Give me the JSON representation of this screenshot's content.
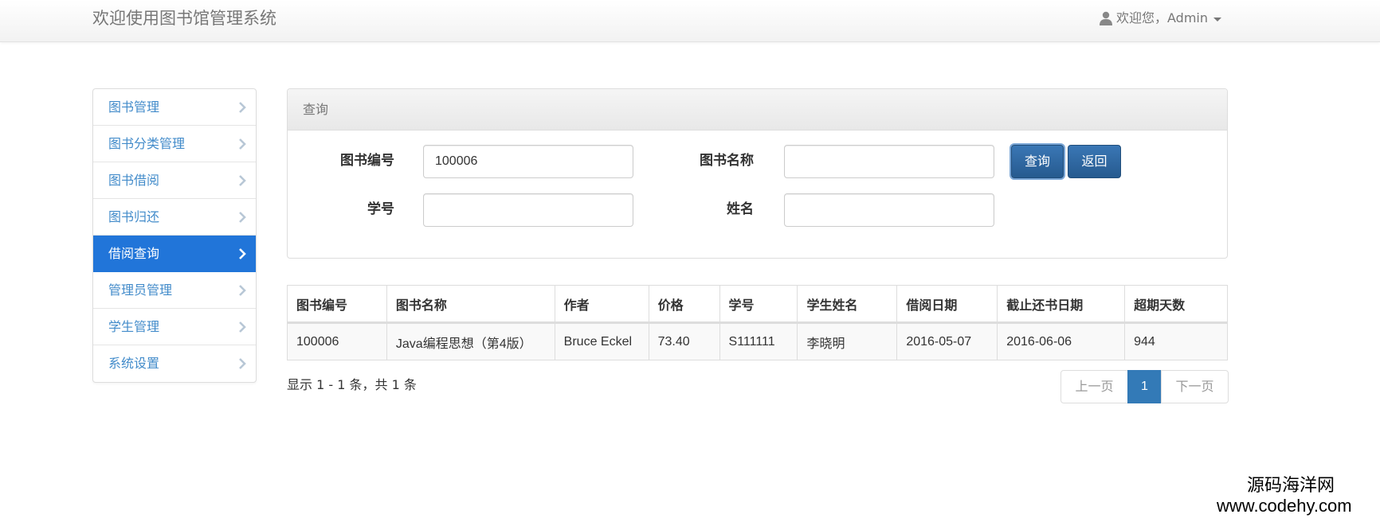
{
  "app": {
    "title": "欢迎使用图书馆管理系统",
    "user_greeting": "欢迎您，Admin"
  },
  "sidebar": {
    "items": [
      {
        "label": "图书管理"
      },
      {
        "label": "图书分类管理"
      },
      {
        "label": "图书借阅"
      },
      {
        "label": "图书归还"
      },
      {
        "label": "借阅查询",
        "active": true
      },
      {
        "label": "管理员管理"
      },
      {
        "label": "学生管理"
      },
      {
        "label": "系统设置"
      }
    ]
  },
  "query": {
    "heading": "查询",
    "book_id_label": "图书编号",
    "book_id_value": "100006",
    "book_name_label": "图书名称",
    "book_name_value": "",
    "student_id_label": "学号",
    "student_id_value": "",
    "student_name_label": "姓名",
    "student_name_value": "",
    "search_button": "查询",
    "back_button": "返回"
  },
  "table": {
    "headers": [
      "图书编号",
      "图书名称",
      "作者",
      "价格",
      "学号",
      "学生姓名",
      "借阅日期",
      "截止还书日期",
      "超期天数"
    ],
    "rows": [
      [
        "100006",
        "Java编程思想（第4版）",
        "Bruce Eckel",
        "73.40",
        "S111111",
        "李晓明",
        "2016-05-07",
        "2016-06-06",
        "944"
      ]
    ]
  },
  "summary": "显示 1 - 1 条，共 1 条",
  "pagination": {
    "prev": "上一页",
    "current": "1",
    "next": "下一页"
  },
  "watermark": {
    "name": "源码海洋网",
    "url": "www.codehy.com"
  },
  "colors": {
    "active_nav": "#2175d9",
    "link": "#428bca",
    "button": "#2d6aa5",
    "page_current": "#337ab7"
  }
}
